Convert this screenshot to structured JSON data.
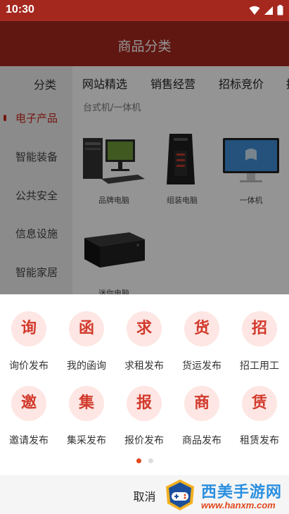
{
  "status_bar": {
    "time": "10:30"
  },
  "app_bar": {
    "title": "商品分类"
  },
  "sidebar": {
    "header": "分类",
    "items": [
      {
        "label": "电子产品",
        "active": true
      },
      {
        "label": "智能装备",
        "active": false
      },
      {
        "label": "公共安全",
        "active": false
      },
      {
        "label": "信息设施",
        "active": false
      },
      {
        "label": "智能家居",
        "active": false
      }
    ]
  },
  "tabs": [
    "网站精选",
    "销售经营",
    "招标竞价",
    "招"
  ],
  "subcategory": "台式机/一体机",
  "products": [
    {
      "name": "品牌电脑"
    },
    {
      "name": "组装电脑"
    },
    {
      "name": "一体机"
    },
    {
      "name": "迷你电脑"
    }
  ],
  "action_sheet": {
    "actions": [
      {
        "icon_char": "询",
        "label": "询价发布"
      },
      {
        "icon_char": "函",
        "label": "我的函询"
      },
      {
        "icon_char": "求",
        "label": "求租发布"
      },
      {
        "icon_char": "货",
        "label": "货运发布"
      },
      {
        "icon_char": "招",
        "label": "招工用工"
      },
      {
        "icon_char": "邀",
        "label": "邀请发布"
      },
      {
        "icon_char": "集",
        "label": "集采发布"
      },
      {
        "icon_char": "报",
        "label": "报价发布"
      },
      {
        "icon_char": "商",
        "label": "商品发布"
      },
      {
        "icon_char": "赁",
        "label": "租赁发布"
      }
    ],
    "page_count": 2,
    "current_page": 1,
    "cancel_label": "取消"
  },
  "watermark": {
    "name": "西美手游网",
    "url": "www.hanxm.com"
  },
  "colors": {
    "brand": "#a5281e",
    "accent": "#d23a2c",
    "icon_circle_bg": "#fde6e3",
    "pager_active": "#e0491e",
    "pager_inactive": "#dddddd"
  }
}
